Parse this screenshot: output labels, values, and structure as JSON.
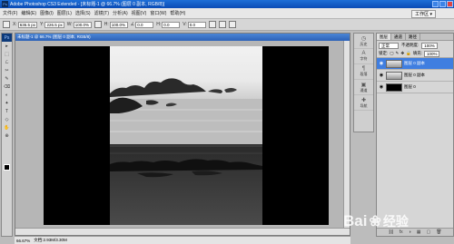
{
  "titlebar": {
    "badge": "Ps",
    "title": "Adobe Photoshop CS3 Extended - [未标题-1 @ 66.7% (图层 0 副本, RGB/8)]"
  },
  "menubar": {
    "items": [
      "文件(F)",
      "编辑(E)",
      "图像(I)",
      "图层(L)",
      "选择(S)",
      "滤镜(T)",
      "分析(A)",
      "视图(V)",
      "窗口(W)",
      "帮助(H)"
    ],
    "workspace": "工作区 ▾"
  },
  "options": {
    "x_label": "X:",
    "x_value": "636.5 px",
    "y_label": "Y:",
    "y_value": "226.5 px",
    "w_label": "W:",
    "w_value": "100.0%",
    "h_label": "H:",
    "h_value": "100.0%",
    "angle_label": "∠",
    "angle_value": "0.0",
    "hskew_label": "H:",
    "hskew_value": "0.0",
    "vskew_label": "V:",
    "vskew_value": "0.0"
  },
  "toolbox": {
    "logo": "Ps",
    "tools": [
      "▸",
      "⬚",
      "ℒ",
      "✂",
      "✎",
      "⌫",
      "◐",
      "✦",
      "T",
      "◇",
      "✋",
      "⊕"
    ]
  },
  "document": {
    "title": "未标题-1 @ 66.7% (图层 0 副本, RGB/8)"
  },
  "statusbar": {
    "zoom": "66.67%",
    "doc_info": "文档:2.93M/3.30M"
  },
  "side_icons": [
    {
      "glyph": "◷",
      "label": "历史"
    },
    {
      "glyph": "A",
      "label": "字符"
    },
    {
      "glyph": "¶",
      "label": "段落"
    },
    {
      "glyph": "▣",
      "label": "通道"
    },
    {
      "glyph": "✚",
      "label": "导航"
    }
  ],
  "layers_panel": {
    "tabs": [
      "图层",
      "通道",
      "路径"
    ],
    "blend_mode": "正常",
    "opacity_label": "不透明度:",
    "opacity_value": "100%",
    "lock_label": "锁定:",
    "fill_label": "填充:",
    "fill_value": "100%",
    "layers": [
      {
        "name": "图层 0 副本",
        "active": true,
        "thumb": "photo"
      },
      {
        "name": "图层 0 副本",
        "active": false,
        "thumb": "photo"
      },
      {
        "name": "图层 0",
        "active": false,
        "thumb": "black"
      }
    ],
    "footer_icons": [
      "⛓",
      "fx",
      "◑",
      "▦",
      "▢",
      "🗑"
    ]
  },
  "watermark": {
    "text": "Bai",
    "cn": "经验"
  }
}
